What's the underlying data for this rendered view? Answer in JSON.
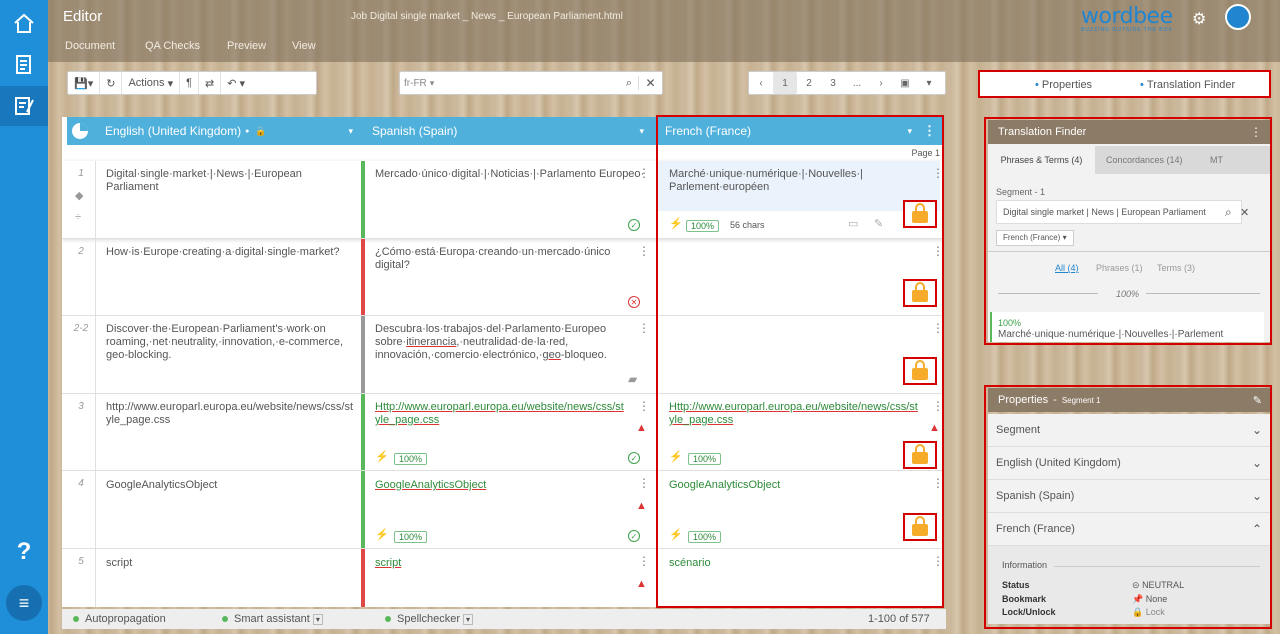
{
  "header": {
    "app_title": "Editor",
    "job_title": "Job Digital single market _ News _ European Parliament.html",
    "nav": [
      "Document",
      "QA Checks",
      "Preview",
      "View"
    ],
    "logo_text": "wordbee",
    "logo_tagline": "BUZZING OUTSIDE THE BOX"
  },
  "toolbar": {
    "actions_label": "Actions",
    "pilcrow": "¶",
    "lang_filter": "fr-FR",
    "pages": [
      "1",
      "2",
      "3",
      "..."
    ]
  },
  "columns": {
    "source": "English (United Kingdom)",
    "target1": "Spanish (Spain)",
    "target2": "French (France)"
  },
  "page_label": "Page 1",
  "rows": [
    {
      "num": "1",
      "source": "Digital·single·market·|·News·|·European Parliament",
      "spanish": "Mercado·único·digital·|·Noticias·|·Parlamento Europeo·",
      "french": "Marché·unique·numérique·|·Nouvelles·| Parlement·européen",
      "match": "100%",
      "chars": "56 chars"
    },
    {
      "num": "2",
      "source": "How·is·Europe·creating·a·digital·single·market?",
      "spanish": "¿Cómo·está·Europa·creando·un·mercado·único digital?",
      "french": ""
    },
    {
      "num": "2-2",
      "source": "Discover·the·European·Parliament's·work·on roaming,·net·neutrality,·innovation,·e-commerce, geo-blocking.",
      "spanish_parts": [
        "Descubra·los·trabajos·del·Parlamento·Europeo sobre·",
        "itinerancia",
        ",·neutralidad·de·la·red, innovación,·comercio·electrónico,·",
        "geo",
        "-bloqueo."
      ],
      "french": ""
    },
    {
      "num": "3",
      "source": "http://www.europarl.europa.eu/website/news/css/style_page.css",
      "spanish": "Http://www.europarl.europa.eu/website/news/css/style_page.css",
      "french": "Http://www.europarl.europa.eu/website/news/css/style_page.css",
      "match": "100%"
    },
    {
      "num": "4",
      "source": "GoogleAnalyticsObject",
      "spanish": "GoogleAnalyticsObject",
      "french": "GoogleAnalyticsObject",
      "match": "100%"
    },
    {
      "num": "5",
      "source": "script",
      "spanish": "script",
      "french": "scénario"
    }
  ],
  "status": {
    "autopropagation": "Autopropagation",
    "smart_assistant": "Smart assistant",
    "spellchecker": "Spellchecker",
    "range": "1-100 of 577"
  },
  "side_tabs": {
    "properties": "Properties",
    "translation_finder": "Translation Finder"
  },
  "finder": {
    "title": "Translation Finder",
    "tabs": [
      "Phrases & Terms (4)",
      "Concordances (14)",
      "MT"
    ],
    "segment_label": "Segment - 1",
    "search_value": "Digital single market | News | European Parliament",
    "lang": "French (France)",
    "filters": [
      "All (4)",
      "Phrases (1)",
      "Terms (3)"
    ],
    "group_pct": "100%",
    "result_pct": "100%",
    "result_text": "Marché·unique·numérique·|·Nouvelles·|·Parlement"
  },
  "properties": {
    "title": "Properties",
    "subtitle": "Segment 1",
    "sections": [
      "Segment",
      "English (United Kingdom)",
      "Spanish (Spain)",
      "French (France)"
    ],
    "info_label": "Information",
    "info": [
      {
        "key": "Status",
        "value": "NEUTRAL"
      },
      {
        "key": "Bookmark",
        "value": "None"
      },
      {
        "key": "Lock/Unlock",
        "value": "Lock"
      }
    ]
  },
  "colors": {
    "rail": "#1f8fd9",
    "grid_header": "#4fb0db",
    "highlight": "#d40000",
    "lock": "#f6ac2a",
    "ok_green": "#3aa04a",
    "error_red": "#d33"
  }
}
